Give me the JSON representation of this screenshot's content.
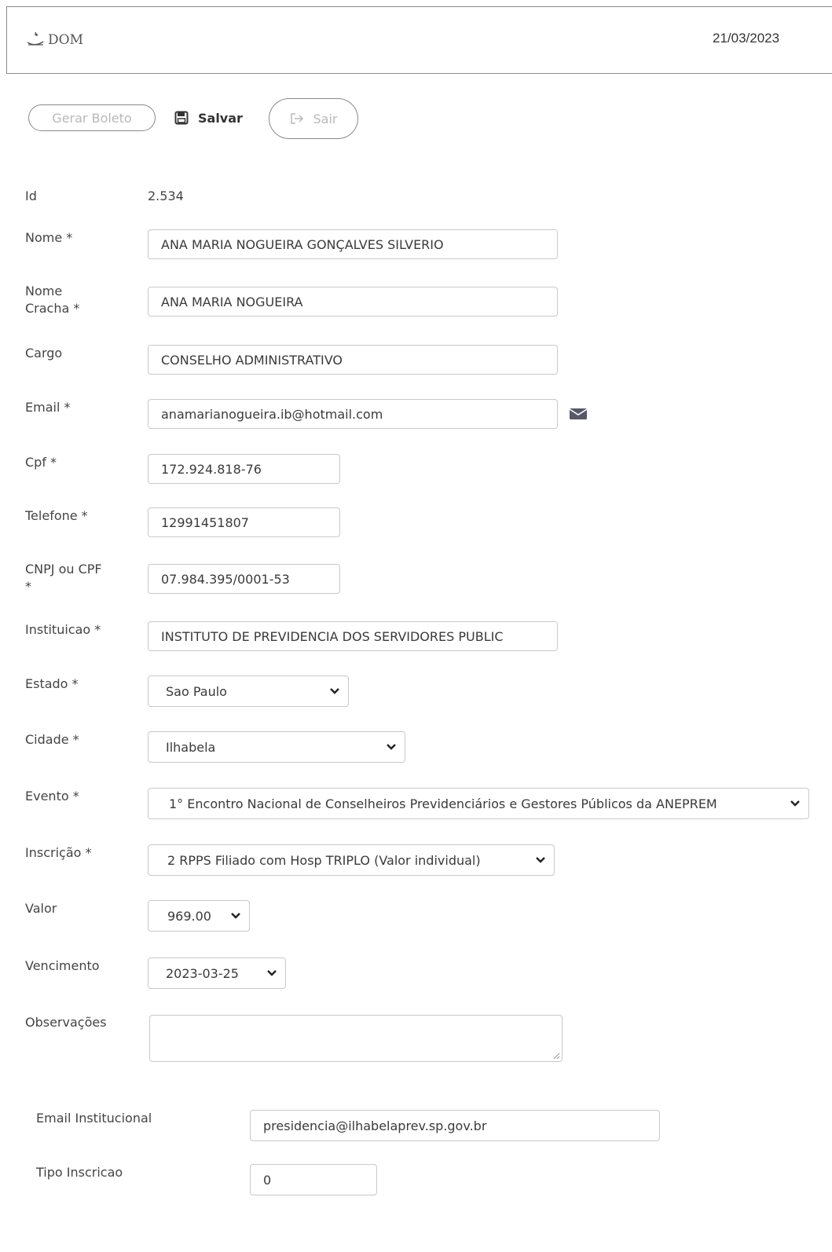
{
  "header": {
    "logo_text": "DOM",
    "date": "21/03/2023"
  },
  "toolbar": {
    "gerar_boleto_label": "Gerar Boleto",
    "salvar_label": "Salvar",
    "sair_label": "Sair"
  },
  "form": {
    "id_label": "Id",
    "id_value": "2.534",
    "nome_label": "Nome *",
    "nome_value": "ANA MARIA NOGUEIRA GONÇALVES SILVERIO",
    "nome_cracha_label_1": "Nome",
    "nome_cracha_label_2": "Cracha *",
    "nome_cracha_value": "ANA MARIA NOGUEIRA",
    "cargo_label": "Cargo",
    "cargo_value": "CONSELHO ADMINISTRATIVO",
    "email_label": "Email *",
    "email_value": "anamarianogueira.ib@hotmail.com",
    "cpf_label": "Cpf *",
    "cpf_value": "172.924.818-76",
    "telefone_label": "Telefone *",
    "telefone_value": "12991451807",
    "cnpj_label_1": "CNPJ ou CPF",
    "cnpj_label_2": "*",
    "cnpj_value": "07.984.395/0001-53",
    "instituicao_label": "Instituicao *",
    "instituicao_value": "INSTITUTO DE PREVIDENCIA DOS SERVIDORES PUBLIC",
    "estado_label": "Estado *",
    "estado_value": "Sao Paulo",
    "cidade_label": "Cidade *",
    "cidade_value": "Ilhabela",
    "evento_label": "Evento *",
    "evento_value": "1° Encontro Nacional de Conselheiros Previdenciários e Gestores Públicos da ANEPREM",
    "inscricao_label": "Inscrição *",
    "inscricao_value": "2 RPPS Filiado com Hosp TRIPLO (Valor individual)",
    "valor_label": "Valor",
    "valor_value": "969.00",
    "vencimento_label": "Vencimento",
    "vencimento_value": "2023-03-25",
    "observacoes_label": "Observações",
    "observacoes_value": "",
    "email_institucional_label": "Email Institucional",
    "email_institucional_value": "presidencia@ilhabelaprev.sp.gov.br",
    "tipo_inscricao_label": "Tipo Inscricao",
    "tipo_inscricao_value": "0"
  },
  "icons": {
    "save": "floppy-disk-icon",
    "exit": "sign-out-icon",
    "email": "envelope-icon",
    "dropdown": "chevron-down-icon"
  }
}
